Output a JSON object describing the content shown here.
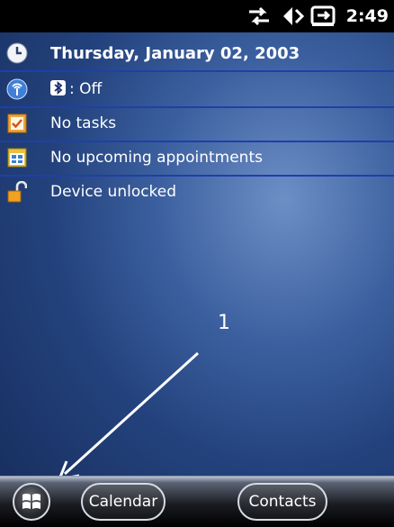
{
  "status_bar": {
    "time": "2:49",
    "icons": [
      "connectivity-icon",
      "speaker-icon",
      "battery-charging-icon"
    ]
  },
  "today": {
    "date": "Thursday, January 02, 2003",
    "wireless": {
      "label": ": Off"
    },
    "tasks": "No tasks",
    "appointments": "No upcoming appointments",
    "lock": "Device unlocked"
  },
  "annotation": {
    "label": "1"
  },
  "softkeys": {
    "left": "Calendar",
    "right": "Contacts"
  },
  "colors": {
    "divider": "#1f3fa8",
    "background": "#23427d"
  }
}
